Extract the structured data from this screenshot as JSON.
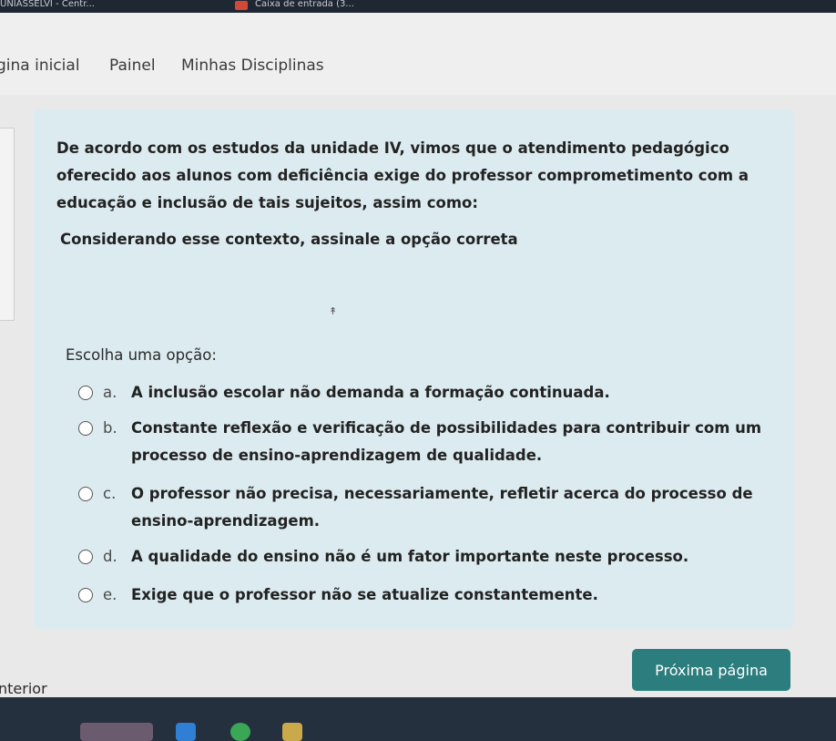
{
  "browser": {
    "tab_1": "UNIASSELVI - Centr...",
    "tab_2": "Caixa de entrada (3..."
  },
  "breadcrumb": {
    "items": [
      "gina inicial",
      "Painel",
      "Minhas Disciplinas"
    ]
  },
  "question": {
    "text": "De acordo com os estudos da unidade IV, vimos que o atendimento pedagógico oferecido aos alunos com deficiência exige do professor comprometimento com a educação e inclusão de tais sujeitos, assim como:",
    "context": "Considerando esse contexto, assinale a opção correta",
    "choose_label": "Escolha uma opção:",
    "options": [
      {
        "letter": "a.",
        "text": "A inclusão escolar não demanda a formação continuada."
      },
      {
        "letter": "b.",
        "text": "Constante reflexão e verificação de possibilidades para contribuir com um processo de ensino-aprendizagem de qualidade."
      },
      {
        "letter": "c.",
        "text": "O professor não precisa, necessariamente, refletir acerca do processo de ensino-aprendizagem."
      },
      {
        "letter": "d.",
        "text": "A qualidade do ensino não é um fator importante neste processo."
      },
      {
        "letter": "e.",
        "text": "Exige que o professor não se atualize constantemente."
      }
    ]
  },
  "navigation": {
    "next_label": "Próxima página",
    "prev_label": "nterior"
  },
  "colors": {
    "card_bg": "#dcebf0",
    "button_bg": "#2c7d7d",
    "taskbar_bg": "#25303f"
  },
  "taskbar_icons": [
    "photo-app-icon",
    "files-icon",
    "chrome-icon",
    "gallery-icon"
  ]
}
